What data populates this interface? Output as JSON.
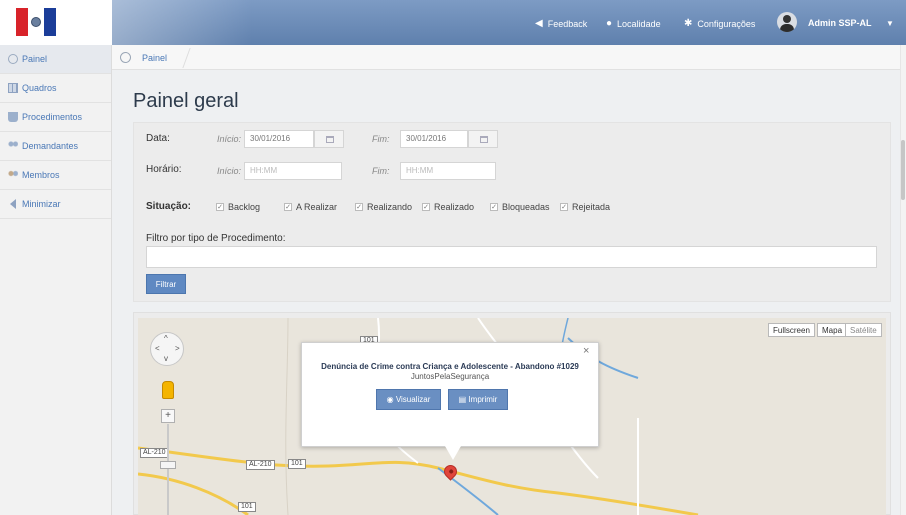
{
  "header": {
    "feedback": "Feedback",
    "localidade": "Localidade",
    "configuracoes": "Configurações",
    "user": "Admin SSP-AL"
  },
  "sidebar": {
    "items": [
      {
        "label": "Painel",
        "icon": "dashboard-icon"
      },
      {
        "label": "Quadros",
        "icon": "grid-icon"
      },
      {
        "label": "Procedimentos",
        "icon": "cup-icon"
      },
      {
        "label": "Demandantes",
        "icon": "people-icon"
      },
      {
        "label": "Membros",
        "icon": "members-icon"
      },
      {
        "label": "Minimizar",
        "icon": "arrow-left-icon"
      }
    ]
  },
  "breadcrumb": "Painel",
  "page_title": "Painel geral",
  "filters": {
    "data_label": "Data:",
    "inicio_label": "Início:",
    "fim_label": "Fim:",
    "data_inicio": "30/01/2016",
    "data_fim": "30/01/2016",
    "horario_label": "Horário:",
    "horario_placeholder": "HH:MM",
    "situacao_label": "Situação:",
    "situacoes": [
      "Backlog",
      "A Realizar",
      "Realizando",
      "Realizado",
      "Bloqueadas",
      "Rejeitada"
    ],
    "procedimento_label": "Filtro por tipo de Procedimento:",
    "filtrar": "Filtrar"
  },
  "map": {
    "fullscreen": "Fullscreen",
    "mapa": "Mapa",
    "satelite": "Satélite",
    "road_labels": [
      "101",
      "AL-210",
      "AL-210",
      "101",
      "101"
    ],
    "info": {
      "title": "Denúncia de Crime contra Criança e Adolescente - Abandono #1029",
      "subtitle": "JuntosPelaSegurança",
      "visualizar": "Visualizar",
      "imprimir": "Imprimir",
      "close": "×"
    }
  },
  "colors": {
    "header": "#6d8db9",
    "accent": "#5f89c2",
    "link": "#4a78b6"
  }
}
